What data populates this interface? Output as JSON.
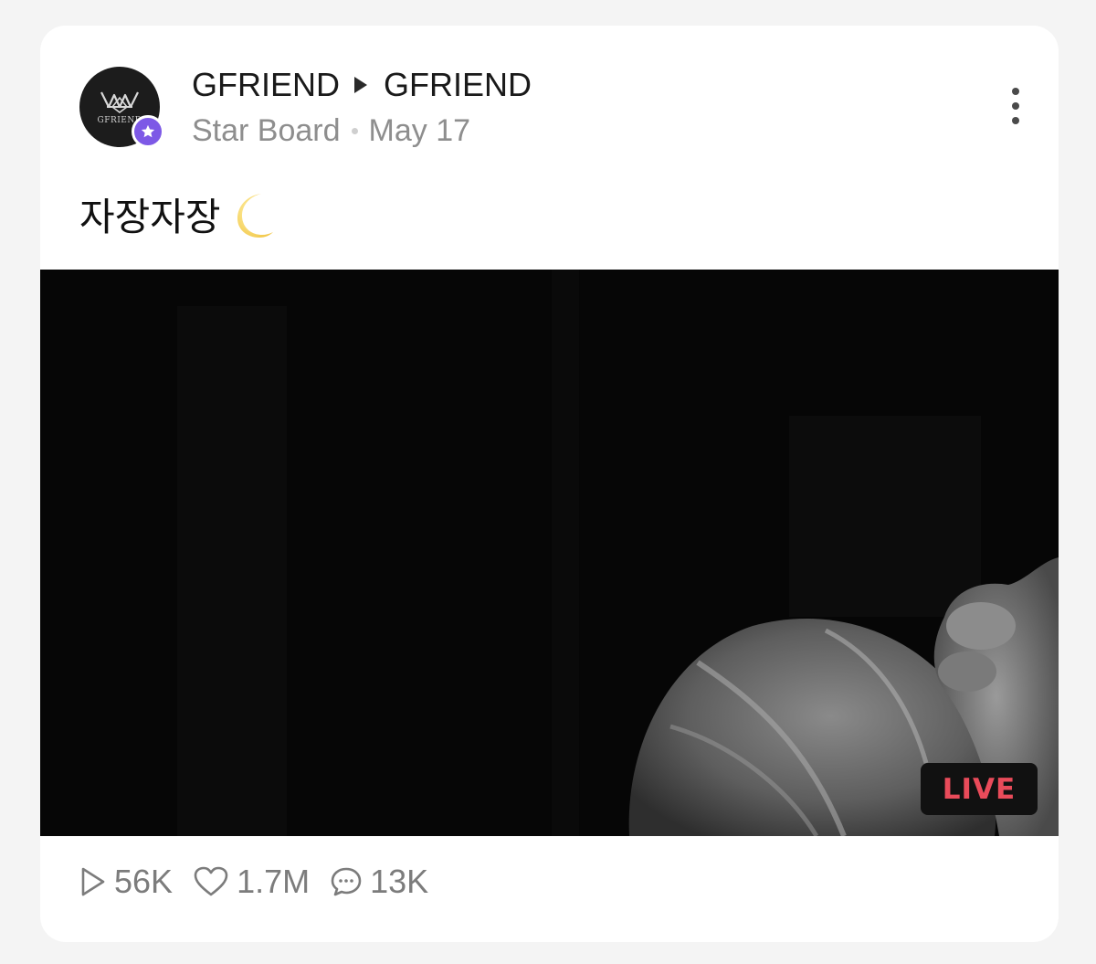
{
  "post": {
    "author": "GFRIEND",
    "board_owner": "GFRIEND",
    "board_name": "Star Board",
    "date": "May 17",
    "text": "자장자장",
    "text_emoji": "crescent-moon",
    "avatar_text": "GFRIEND"
  },
  "video": {
    "live_label": "LIVE"
  },
  "stats": {
    "plays": "56K",
    "likes": "1.7M",
    "comments": "13K"
  },
  "icons": {
    "more": "more-vertical-icon",
    "play": "play-icon",
    "like": "heart-icon",
    "comment": "comment-icon",
    "star": "star-icon"
  },
  "colors": {
    "badge": "#7d59e6",
    "live": "#e94b5a",
    "background": "#f4f4f4"
  }
}
